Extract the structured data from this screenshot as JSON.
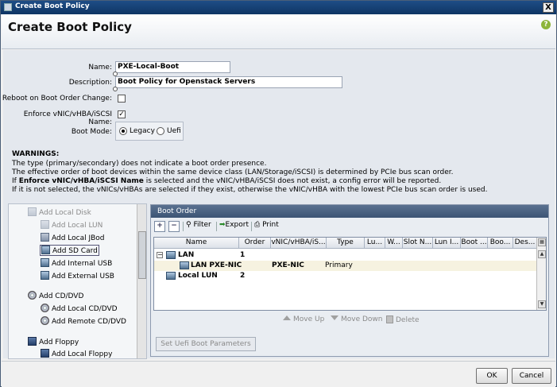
{
  "window": {
    "title": "Create Boot Policy",
    "close_label": "X"
  },
  "header": {
    "title": "Create Boot Policy",
    "help_label": "?"
  },
  "form": {
    "name_label": "Name:",
    "name_value": "PXE-Local-Boot",
    "description_label": "Description:",
    "description_value": "Boot Policy for Openstack Servers",
    "reboot_label": "Reboot on Boot Order Change:",
    "reboot_checked": false,
    "enforce_label": "Enforce vNIC/vHBA/iSCSI Name:",
    "enforce_checked": true,
    "boot_mode_label": "Boot Mode:",
    "boot_mode_options": [
      "Legacy",
      "Uefi"
    ],
    "boot_mode_selected": "Legacy"
  },
  "warnings": {
    "title": "WARNINGS:",
    "line1": "The type (primary/secondary) does not indicate a boot order presence.",
    "line2": "The effective order of boot devices within the same device class (LAN/Storage/iSCSI) is determined by PCIe bus scan order.",
    "line3_pre": "If ",
    "line3_bold": "Enforce vNIC/vHBA/iSCSI Name",
    "line3_post": " is selected and the vNIC/vHBA/iSCSI does not exist, a config error will be reported.",
    "line4": "If it is not selected, the vNICs/vHBAs are selected if they exist, otherwise the vNIC/vHBA with the lowest PCIe bus scan order is used."
  },
  "left_panel": {
    "items": [
      {
        "label": "Add Local Disk",
        "icon": "disk-icon"
      },
      {
        "label": "Add Local LUN",
        "icon": "disk-icon"
      },
      {
        "label": "Add Local JBod",
        "icon": "disk-icon"
      },
      {
        "label": "Add SD Card",
        "icon": "sd-card-icon"
      },
      {
        "label": "Add Internal USB",
        "icon": "usb-icon"
      },
      {
        "label": "Add External USB",
        "icon": "usb-icon"
      },
      {
        "label": "Add CD/DVD",
        "icon": "cd-icon"
      },
      {
        "label": "Add Local CD/DVD",
        "icon": "cd-icon"
      },
      {
        "label": "Add Remote CD/DVD",
        "icon": "cd-icon"
      },
      {
        "label": "Add Floppy",
        "icon": "floppy-icon"
      },
      {
        "label": "Add Local Floppy",
        "icon": "floppy-icon"
      }
    ]
  },
  "boot_order": {
    "title": "Boot Order",
    "toolbar": {
      "add": "+",
      "remove": "−",
      "filter": "Filter",
      "export": "Export",
      "print": "Print"
    },
    "columns": [
      "Name",
      "Order",
      "vNIC/vHBA/iS...",
      "Type",
      "Lu...",
      "W...",
      "Slot N...",
      "Lun I...",
      "Boot ...",
      "Boo...",
      "Des..."
    ],
    "rows": [
      {
        "name": "LAN",
        "order": "1",
        "vnic": "",
        "type": ""
      },
      {
        "name": "LAN PXE-NIC",
        "order": "",
        "vnic": "PXE-NIC",
        "type": "Primary"
      },
      {
        "name": "Local LUN",
        "order": "2",
        "vnic": "",
        "type": ""
      }
    ],
    "move_up": "Move Up",
    "move_down": "Move Down",
    "delete": "Delete",
    "uefi_button": "Set Uefi Boot Parameters"
  },
  "footer": {
    "ok": "OK",
    "cancel": "Cancel"
  }
}
